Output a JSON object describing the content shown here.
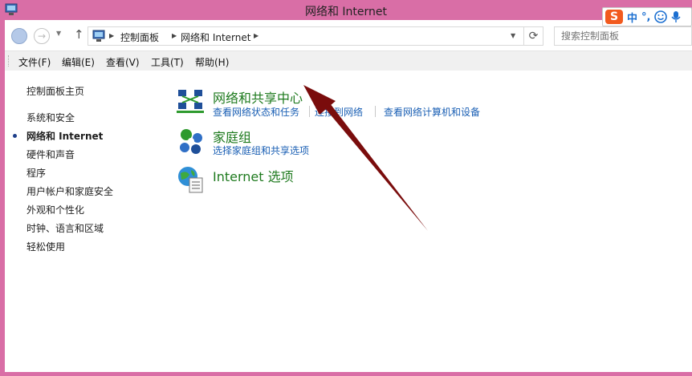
{
  "window": {
    "title": "网络和 Internet",
    "frame_color": "#d96ea6"
  },
  "ime": {
    "logo": "S",
    "mode": "中",
    "punct": "°,",
    "emoji_icon": "smiley-icon",
    "mic_icon": "microphone-icon"
  },
  "address": {
    "crumbs": [
      "控制面板",
      "网络和 Internet"
    ],
    "search_placeholder": "搜索控制面板"
  },
  "menu": [
    "文件(F)",
    "编辑(E)",
    "查看(V)",
    "工具(T)",
    "帮助(H)"
  ],
  "sidebar": {
    "home": "控制面板主页",
    "items": [
      "系统和安全",
      "网络和 Internet",
      "硬件和声音",
      "程序",
      "用户帐户和家庭安全",
      "外观和个性化",
      "时钟、语言和区域",
      "轻松使用"
    ],
    "active_index": 1
  },
  "categories": [
    {
      "title": "网络和共享中心",
      "icon": "network-sharing-center-icon",
      "tasks": [
        "查看网络状态和任务",
        "连接到网络",
        "查看网络计算机和设备"
      ]
    },
    {
      "title": "家庭组",
      "icon": "homegroup-icon",
      "tasks": [
        "选择家庭组和共享选项"
      ]
    },
    {
      "title": "Internet 选项",
      "icon": "internet-options-icon",
      "tasks": []
    }
  ],
  "colors": {
    "category_title": "#1e7a1e",
    "task_link": "#1a5fb4",
    "annotation_arrow": "#7a0c0c"
  }
}
